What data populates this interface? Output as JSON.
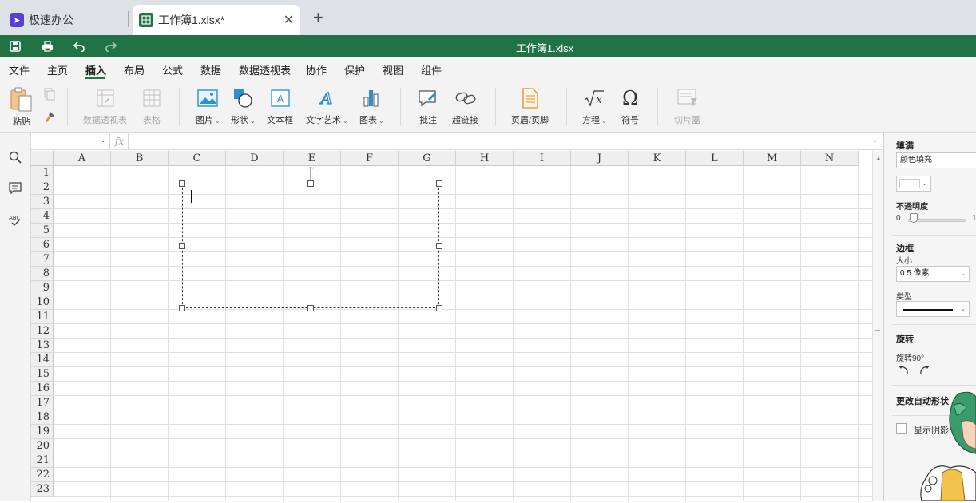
{
  "tabs": [
    {
      "label": "极速办公",
      "logo": "rocket-icon"
    },
    {
      "label": "工作簿1.xlsx*",
      "logo": "sheet-icon"
    }
  ],
  "titlebar": {
    "title": "工作簿1.xlsx"
  },
  "menu": [
    "文件",
    "主页",
    "插入",
    "布局",
    "公式",
    "数据",
    "数据透视表",
    "协作",
    "保护",
    "视图",
    "组件"
  ],
  "menu_active": "插入",
  "ribbon": {
    "paste": "粘贴",
    "pivot": "数据透视表",
    "table": "表格",
    "image": "图片",
    "shape": "形状",
    "textbox": "文本框",
    "wordart": "文字艺术",
    "chart": "图表",
    "comment": "批注",
    "hyperlink": "超链接",
    "header_footer": "页眉/页脚",
    "equation": "方程",
    "symbol": "符号",
    "slicer": "切片器"
  },
  "formula_bar": {
    "fx": "fx"
  },
  "grid": {
    "columns": [
      "A",
      "B",
      "C",
      "D",
      "E",
      "F",
      "G",
      "H",
      "I",
      "J",
      "K",
      "L",
      "M",
      "N"
    ],
    "rows": [
      "1",
      "2",
      "3",
      "4",
      "5",
      "6",
      "7",
      "8",
      "9",
      "10",
      "11",
      "12",
      "13",
      "14",
      "15",
      "16",
      "17",
      "18",
      "19",
      "20",
      "21",
      "22",
      "23"
    ]
  },
  "panel": {
    "fill_title": "填满",
    "fill_type": "颜色填充",
    "opacity_title": "不透明度",
    "opacity_min": "0",
    "opacity_max": "1",
    "opacity_value": 0,
    "border_title": "边框",
    "size_label": "大小",
    "size_value": "0.5 像素",
    "type_label": "类型",
    "rotation_title": "旋转",
    "rotate90_label": "旋转90°",
    "autoshape_title": "更改自动形状",
    "shadow_label": "显示阴影"
  },
  "colors": {
    "accent": "#217346",
    "tab_logo": "#5b3fd4"
  }
}
